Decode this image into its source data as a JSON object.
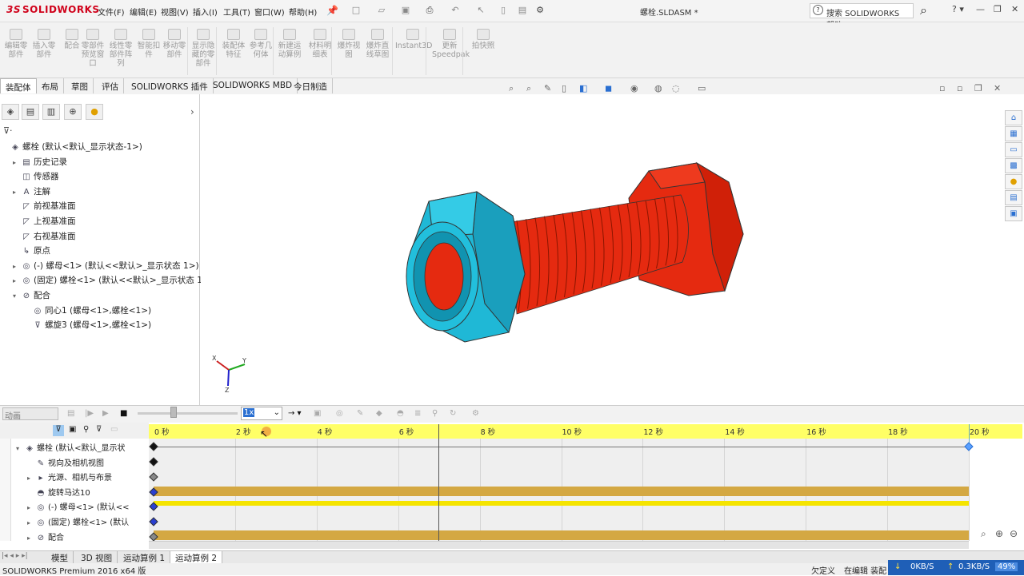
{
  "app": {
    "logo_text": "SOLIDWORKS",
    "doc_title": "螺栓.SLDASM *"
  },
  "menu": [
    "文件(F)",
    "编辑(E)",
    "视图(V)",
    "插入(I)",
    "工具(T)",
    "窗口(W)",
    "帮助(H)"
  ],
  "help_search": {
    "placeholder": "搜索 SOLIDWORKS 帮助"
  },
  "commands": [
    {
      "label": "编辑零\n部件"
    },
    {
      "label": "插入零\n部件"
    },
    {
      "label": "配合"
    },
    {
      "label": "零部件\n预览窗\n口"
    },
    {
      "label": "线性零\n部件阵\n列"
    },
    {
      "label": "智能扣\n件"
    },
    {
      "label": "移动零\n部件"
    },
    {
      "label": "显示隐\n藏的零\n部件"
    },
    {
      "label": "装配体\n特征"
    },
    {
      "label": "参考几\n何体"
    },
    {
      "label": "新建运\n动算例"
    },
    {
      "label": "材料明\n细表"
    },
    {
      "label": "爆炸视\n图"
    },
    {
      "label": "爆炸直\n线草图"
    },
    {
      "label": "Instant3D"
    },
    {
      "label": "更新\nSpeedpak"
    },
    {
      "label": "拍快照"
    }
  ],
  "tabs": [
    "装配体",
    "布局",
    "草图",
    "评估",
    "SOLIDWORKS 插件",
    "SOLIDWORKS MBD",
    "今日制造"
  ],
  "tree": [
    {
      "label": "螺栓  (默认<默认_显示状态-1>)",
      "icon": "assembly-icon",
      "indent": 0,
      "expand": ""
    },
    {
      "label": "历史记录",
      "icon": "history-icon",
      "indent": 1,
      "expand": "▸"
    },
    {
      "label": "传感器",
      "icon": "sensor-icon",
      "indent": 1,
      "expand": ""
    },
    {
      "label": "注解",
      "icon": "annotation-icon",
      "indent": 1,
      "expand": "▸"
    },
    {
      "label": "前视基准面",
      "icon": "plane-icon",
      "indent": 1,
      "expand": ""
    },
    {
      "label": "上视基准面",
      "icon": "plane-icon",
      "indent": 1,
      "expand": ""
    },
    {
      "label": "右视基准面",
      "icon": "plane-icon",
      "indent": 1,
      "expand": ""
    },
    {
      "label": "原点",
      "icon": "origin-icon",
      "indent": 1,
      "expand": ""
    },
    {
      "label": "(-) 螺母<1> (默认<<默认>_显示状态 1>)",
      "icon": "part-icon",
      "indent": 1,
      "expand": "▸"
    },
    {
      "label": "(固定) 螺栓<1> (默认<<默认>_显示状态 1>)",
      "icon": "part-icon",
      "indent": 1,
      "expand": "▸"
    },
    {
      "label": "配合",
      "icon": "mates-icon",
      "indent": 1,
      "expand": "▾"
    },
    {
      "label": "同心1 (螺母<1>,螺栓<1>)",
      "icon": "concentric-icon",
      "indent": 2,
      "expand": ""
    },
    {
      "label": "螺旋3 (螺母<1>,螺栓<1>)",
      "icon": "screw-mate-icon",
      "indent": 2,
      "expand": ""
    }
  ],
  "motion": {
    "study_type": "动画",
    "speed": "1x",
    "time_labels": [
      "0 秒",
      "2 秒",
      "4 秒",
      "6 秒",
      "8 秒",
      "10 秒",
      "12 秒",
      "14 秒",
      "16 秒",
      "18 秒",
      "20 秒"
    ],
    "tree": [
      {
        "label": "螺栓  (默认<默认_显示状",
        "expand": "▾"
      },
      {
        "label": "视向及相机视图",
        "expand": ""
      },
      {
        "label": "光源、相机与布景",
        "expand": "▸"
      },
      {
        "label": "旋转马达10",
        "expand": ""
      },
      {
        "label": "(-) 螺母<1> (默认<<",
        "expand": "▸"
      },
      {
        "label": "(固定) 螺栓<1> (默认",
        "expand": "▸"
      },
      {
        "label": "配合",
        "expand": "▸"
      }
    ]
  },
  "bottom_tabs": [
    "模型",
    "3D 视图",
    "运动算例 1",
    "运动算例 2"
  ],
  "status": {
    "left": "SOLIDWORKS Premium 2016 x64 版",
    "mid1": "欠定义",
    "mid2": "在编辑 装配",
    "down": "0KB/S",
    "up": "0.3KB/S",
    "pct": "49%"
  },
  "colors": {
    "nut": "#1fb8d6",
    "bolt": "#e52a10",
    "accent": "#2a6fd1"
  }
}
